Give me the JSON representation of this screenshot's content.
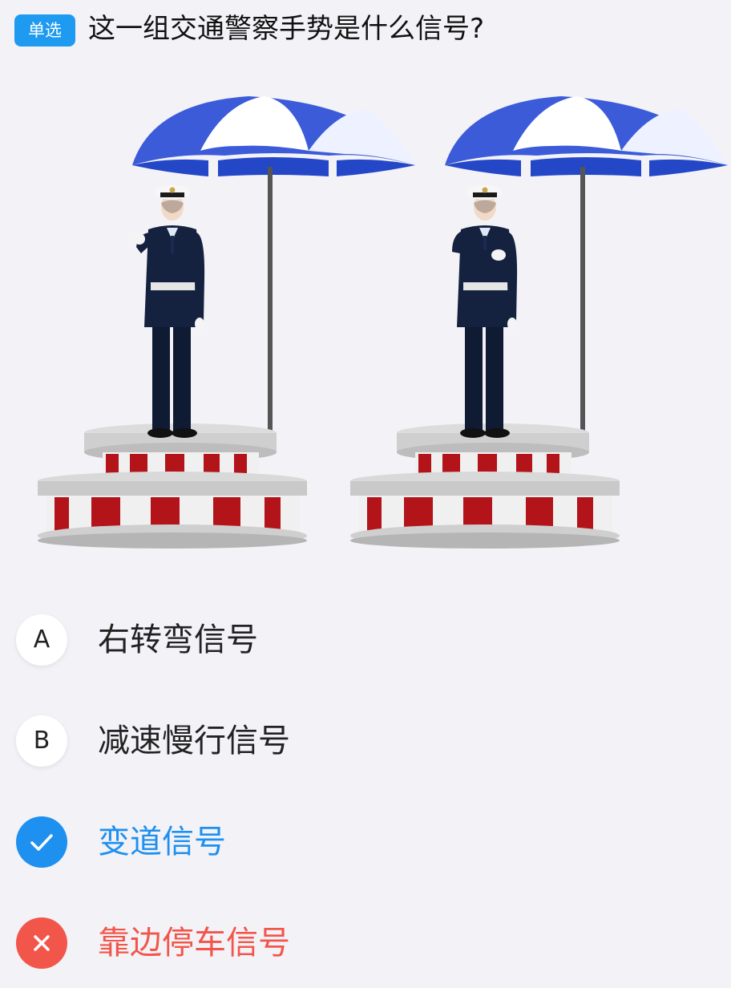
{
  "question": {
    "type_label": "单选",
    "text": "这一组交通警察手势是什么信号?"
  },
  "illustration": {
    "figures": [
      {
        "gesture": "right-arm-extended-forward"
      },
      {
        "gesture": "right-arm-bent-across-chest"
      }
    ]
  },
  "options": [
    {
      "key": "A",
      "label": "右转弯信号",
      "state": "default"
    },
    {
      "key": "B",
      "label": "减速慢行信号",
      "state": "default"
    },
    {
      "key": "C",
      "label": "变道信号",
      "state": "correct",
      "icon": "check-icon"
    },
    {
      "key": "D",
      "label": "靠边停车信号",
      "state": "wrong",
      "icon": "close-icon"
    }
  ],
  "colors": {
    "accent_blue": "#1e90f0",
    "badge_blue": "#1e9bf0",
    "error_red": "#f2564a",
    "background": "#f3f2f7"
  }
}
